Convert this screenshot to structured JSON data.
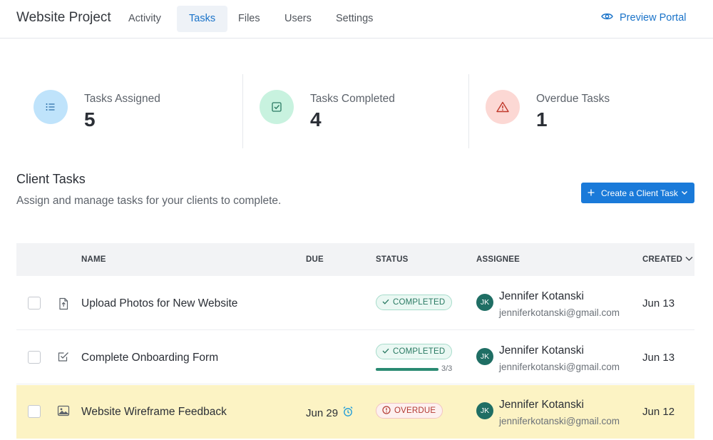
{
  "header": {
    "title": "Website Project",
    "tabs": [
      {
        "label": "Activity"
      },
      {
        "label": "Tasks",
        "active": true
      },
      {
        "label": "Files"
      },
      {
        "label": "Users"
      },
      {
        "label": "Settings"
      }
    ],
    "preview_label": "Preview Portal"
  },
  "stats": [
    {
      "label": "Tasks Assigned",
      "value": "5",
      "icon": "list-icon",
      "color": "#bfe3fb"
    },
    {
      "label": "Tasks Completed",
      "value": "4",
      "icon": "checkbox-check-icon",
      "color": "#c8f2df"
    },
    {
      "label": "Overdue Tasks",
      "value": "1",
      "icon": "warning-triangle-icon",
      "color": "#fcd8d4"
    }
  ],
  "section": {
    "title": "Client Tasks",
    "subtitle": "Assign and manage tasks for your clients to complete.",
    "create_button": "Create a Client Task"
  },
  "table": {
    "columns": {
      "name": "NAME",
      "due": "DUE",
      "status": "STATUS",
      "assignee": "ASSIGNEE",
      "created": "CREATED"
    },
    "rows": [
      {
        "name": "Upload Photos for New Website",
        "type_icon": "file-upload-icon",
        "due": "",
        "status": "COMPLETED",
        "progress": null,
        "assignee_initials": "JK",
        "assignee_name": "Jennifer Kotanski",
        "assignee_email": "jenniferkotanski@gmail.com",
        "created": "Jun 13"
      },
      {
        "name": "Complete Onboarding Form",
        "type_icon": "form-check-icon",
        "due": "",
        "status": "COMPLETED",
        "progress": {
          "text": "3/3",
          "fraction": 1.0
        },
        "assignee_initials": "JK",
        "assignee_name": "Jennifer Kotanski",
        "assignee_email": "jenniferkotanski@gmail.com",
        "created": "Jun 13"
      },
      {
        "name": "Website Wireframe Feedback",
        "type_icon": "image-icon",
        "due": "Jun 29",
        "status": "OVERDUE",
        "progress": null,
        "assignee_initials": "JK",
        "assignee_name": "Jennifer Kotanski",
        "assignee_email": "jenniferkotanski@gmail.com",
        "created": "Jun 12"
      }
    ]
  },
  "colors": {
    "accent": "#1a7ad9",
    "completed": "#2a7a63",
    "overdue": "#b23a32",
    "overdue_row": "#fcf3c4"
  }
}
